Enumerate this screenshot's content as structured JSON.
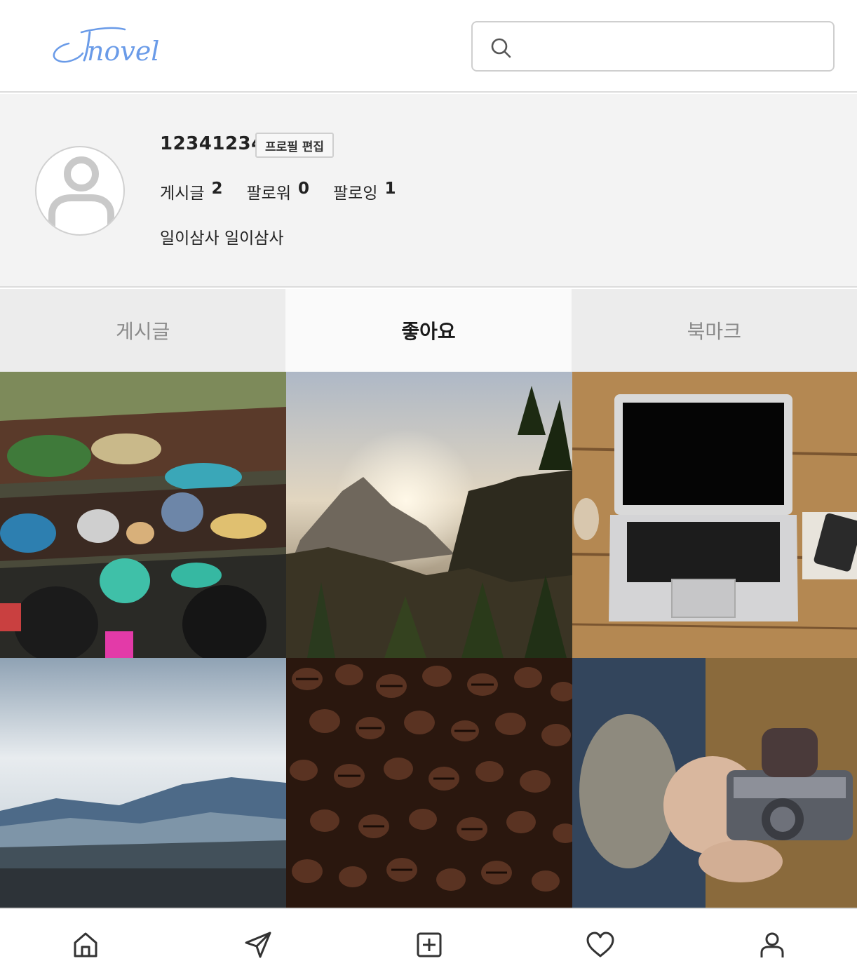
{
  "header": {
    "logo_text": "Tnovel",
    "search_placeholder": "",
    "search_value": ""
  },
  "profile": {
    "username": "12341234",
    "edit_label": "프로필 편집",
    "stats": [
      {
        "label": "게시글",
        "value": "2"
      },
      {
        "label": "팔로워",
        "value": "0"
      },
      {
        "label": "팔로잉",
        "value": "1"
      }
    ],
    "bio": "일이삼사 일이삼사"
  },
  "tabs": [
    {
      "label": "게시글",
      "active": false
    },
    {
      "label": "좋아요",
      "active": true
    },
    {
      "label": "북마크",
      "active": false
    }
  ],
  "grid": {
    "images": [
      "floating-market-photo",
      "mountain-sunset-photo",
      "laptop-desk-photo",
      "misty-mountains-photo",
      "coffee-beans-photo",
      "camera-hands-photo"
    ]
  },
  "bottom_nav": {
    "icons": [
      "home-icon",
      "send-icon",
      "add-post-icon",
      "heart-icon",
      "profile-icon"
    ]
  },
  "colors": {
    "logo_blue": "#6a9be8",
    "tab_active_bg": "#fafafa",
    "tab_inactive_bg": "#ececec",
    "profile_bg": "#f3f3f3"
  }
}
